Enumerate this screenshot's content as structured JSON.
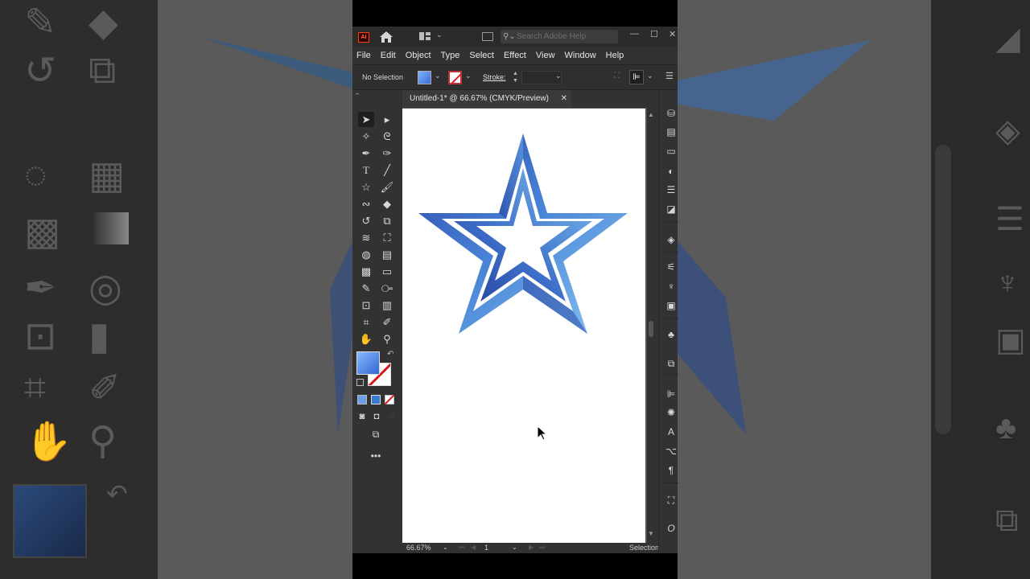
{
  "app": {
    "search_placeholder": "Search Adobe Help",
    "logo_text": "Ai"
  },
  "menu": {
    "items": [
      "File",
      "Edit",
      "Object",
      "Type",
      "Select",
      "Effect",
      "View",
      "Window",
      "Help"
    ]
  },
  "control_bar": {
    "selection_label": "No Selection",
    "stroke_label": "Stroke:",
    "stroke_value": ""
  },
  "document": {
    "tab_title": "Untitled-1* @ 66.67% (CMYK/Preview)"
  },
  "status_bar": {
    "zoom": "66.67%",
    "page": "1",
    "tool": "Selection"
  },
  "colors": {
    "fill_gradient_start": "#86b8ff",
    "fill_gradient_end": "#3266d0",
    "star_dark": "#2a47a8",
    "star_light": "#7ec0f0",
    "stroke_none": "#d41a1a"
  }
}
